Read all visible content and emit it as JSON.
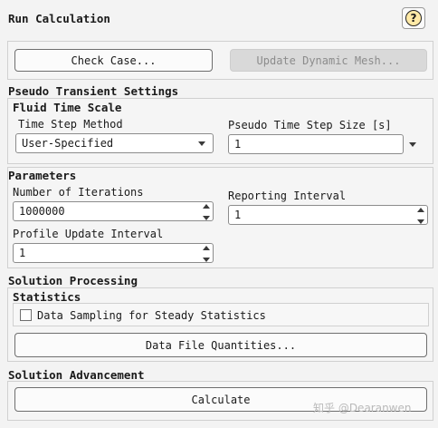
{
  "header": {
    "title": "Run Calculation",
    "help_glyph": "?"
  },
  "toolbar": {
    "check_case_label": "Check Case...",
    "update_mesh_label": "Update Dynamic Mesh..."
  },
  "pseudo": {
    "section_title": "Pseudo Transient Settings",
    "fluid_title": "Fluid Time Scale",
    "method_label": "Time Step Method",
    "method_value": "User-Specified",
    "step_size_label": "Pseudo Time Step Size [s]",
    "step_size_value": "1"
  },
  "parameters": {
    "section_title": "Parameters",
    "iterations_label": "Number of Iterations",
    "iterations_value": "1000000",
    "reporting_label": "Reporting Interval",
    "reporting_value": "1",
    "profile_label": "Profile Update Interval",
    "profile_value": "1"
  },
  "processing": {
    "section_title": "Solution Processing",
    "statistics_title": "Statistics",
    "sampling_label": "Data Sampling for Steady Statistics",
    "sampling_checked": false,
    "quantities_label": "Data File Quantities..."
  },
  "advancement": {
    "section_title": "Solution Advancement",
    "calculate_label": "Calculate"
  },
  "watermark": {
    "text": "知乎 @Dearanwen"
  },
  "colors": {
    "help_fill": "#ffe9a6",
    "disabled_button": "#d9d9d9",
    "panel_bg": "#f3f3f3"
  }
}
